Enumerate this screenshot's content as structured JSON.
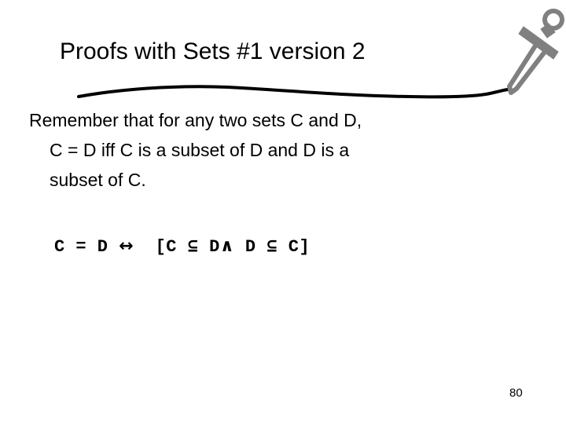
{
  "slide": {
    "title": "Proofs with Sets #1 version 2",
    "page_number": "80",
    "background_color": "#ffffff",
    "text_color": "#000000",
    "decoration_color": "#808080",
    "body_paragraph": {
      "line_1": "Remember that for any two sets C and D,",
      "line_2": "C = D iff C is a subset of D and D is a",
      "line_3": "subset of C."
    },
    "formula": {
      "full": "C = D ↔ [C ⊆ D ∧ D ⊆ C]",
      "left_side": "C = D",
      "biconditional": "↔",
      "open_bracket": "[",
      "term_1": "C ⊆ D",
      "conjunction": "∧",
      "term_2": "D ⊆ C",
      "close_bracket": "]"
    },
    "graphics": {
      "sword": "sword-icon",
      "underline": "wavy-underline-icon"
    }
  }
}
